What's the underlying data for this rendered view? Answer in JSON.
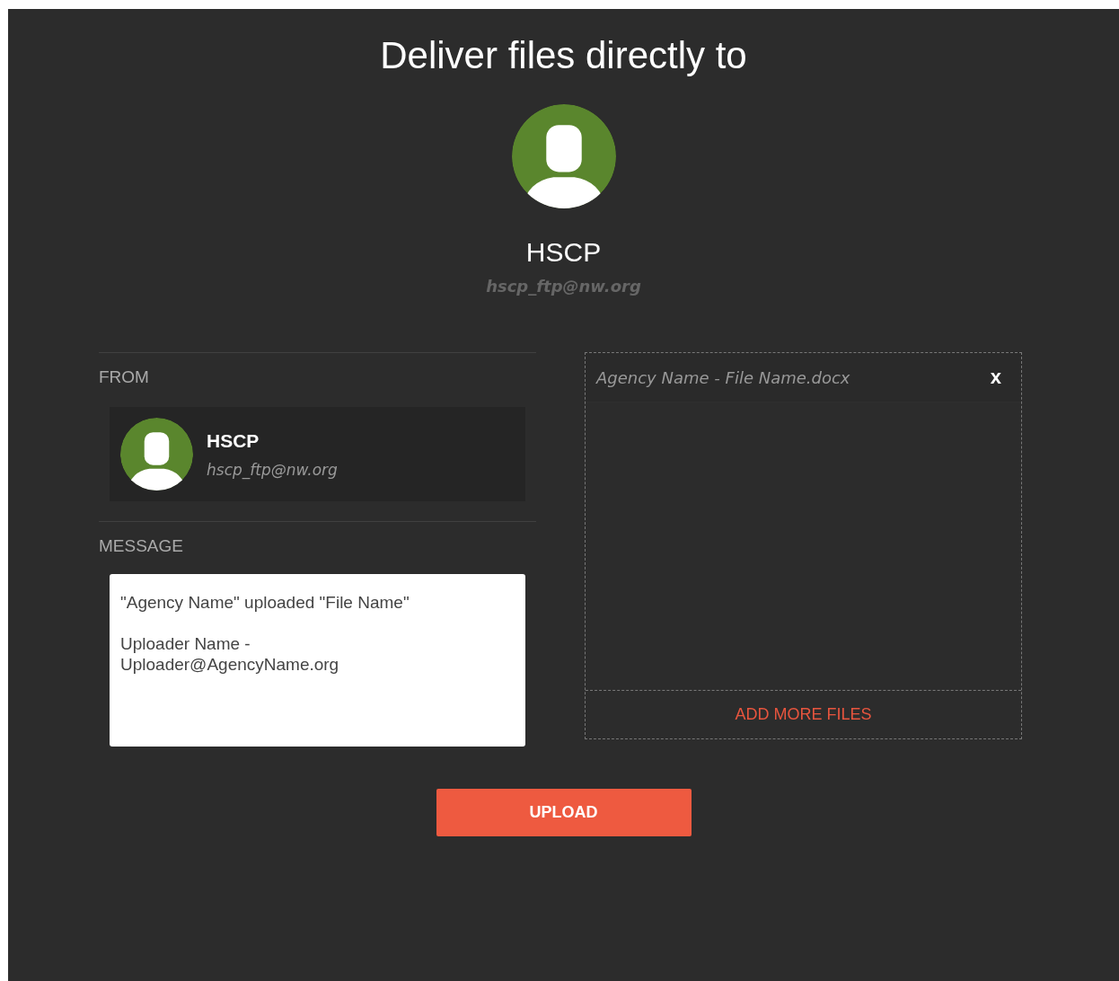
{
  "title": "Deliver files directly to",
  "recipient": {
    "name": "HSCP",
    "email": "hscp_ftp@nw.org"
  },
  "from": {
    "label": "FROM",
    "name": "HSCP",
    "email": "hscp_ftp@nw.org"
  },
  "message": {
    "label": "MESSAGE",
    "value": "\"Agency Name\" uploaded \"File Name\"\n\nUploader Name -\nUploader@AgencyName.org"
  },
  "files": {
    "items": [
      {
        "name": "Agency Name - File Name.docx",
        "remove": "x"
      }
    ],
    "add_label": "ADD MORE FILES"
  },
  "upload_button": "UPLOAD"
}
